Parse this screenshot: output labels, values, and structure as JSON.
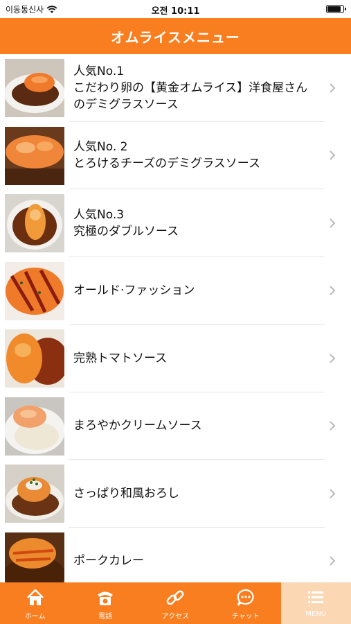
{
  "status_bar": {
    "carrier": "이동통신사",
    "time": "오전 10:11"
  },
  "header": {
    "title": "オムライスメニュー"
  },
  "menu_items": [
    {
      "line1": "人気No.1",
      "line2": "こだわり卵の【黄金オムライス】洋食屋さん",
      "line3": "のデミグラスソース"
    },
    {
      "line1": "人気No. 2",
      "line2": "とろけるチーズのデミグラスソース"
    },
    {
      "line1": "人気No.3",
      "line2": "究極のダブルソース"
    },
    {
      "line1": "オールド·ファッション"
    },
    {
      "line1": "完熟トマトソース"
    },
    {
      "line1": "まろやかクリームソース"
    },
    {
      "line1": "さっぱり和風おろし"
    },
    {
      "line1": "ポークカレー"
    }
  ],
  "tab_bar": [
    {
      "label": "ホーム",
      "icon": "home-icon"
    },
    {
      "label": "電話",
      "icon": "phone-icon"
    },
    {
      "label": "アクセス",
      "icon": "link-icon"
    },
    {
      "label": "チャット",
      "icon": "chat-icon"
    },
    {
      "label": "MENU",
      "icon": "menu-icon",
      "active": true
    }
  ],
  "colors": {
    "brand": "#f97e1f",
    "active_tab": "#fbd7b4"
  }
}
